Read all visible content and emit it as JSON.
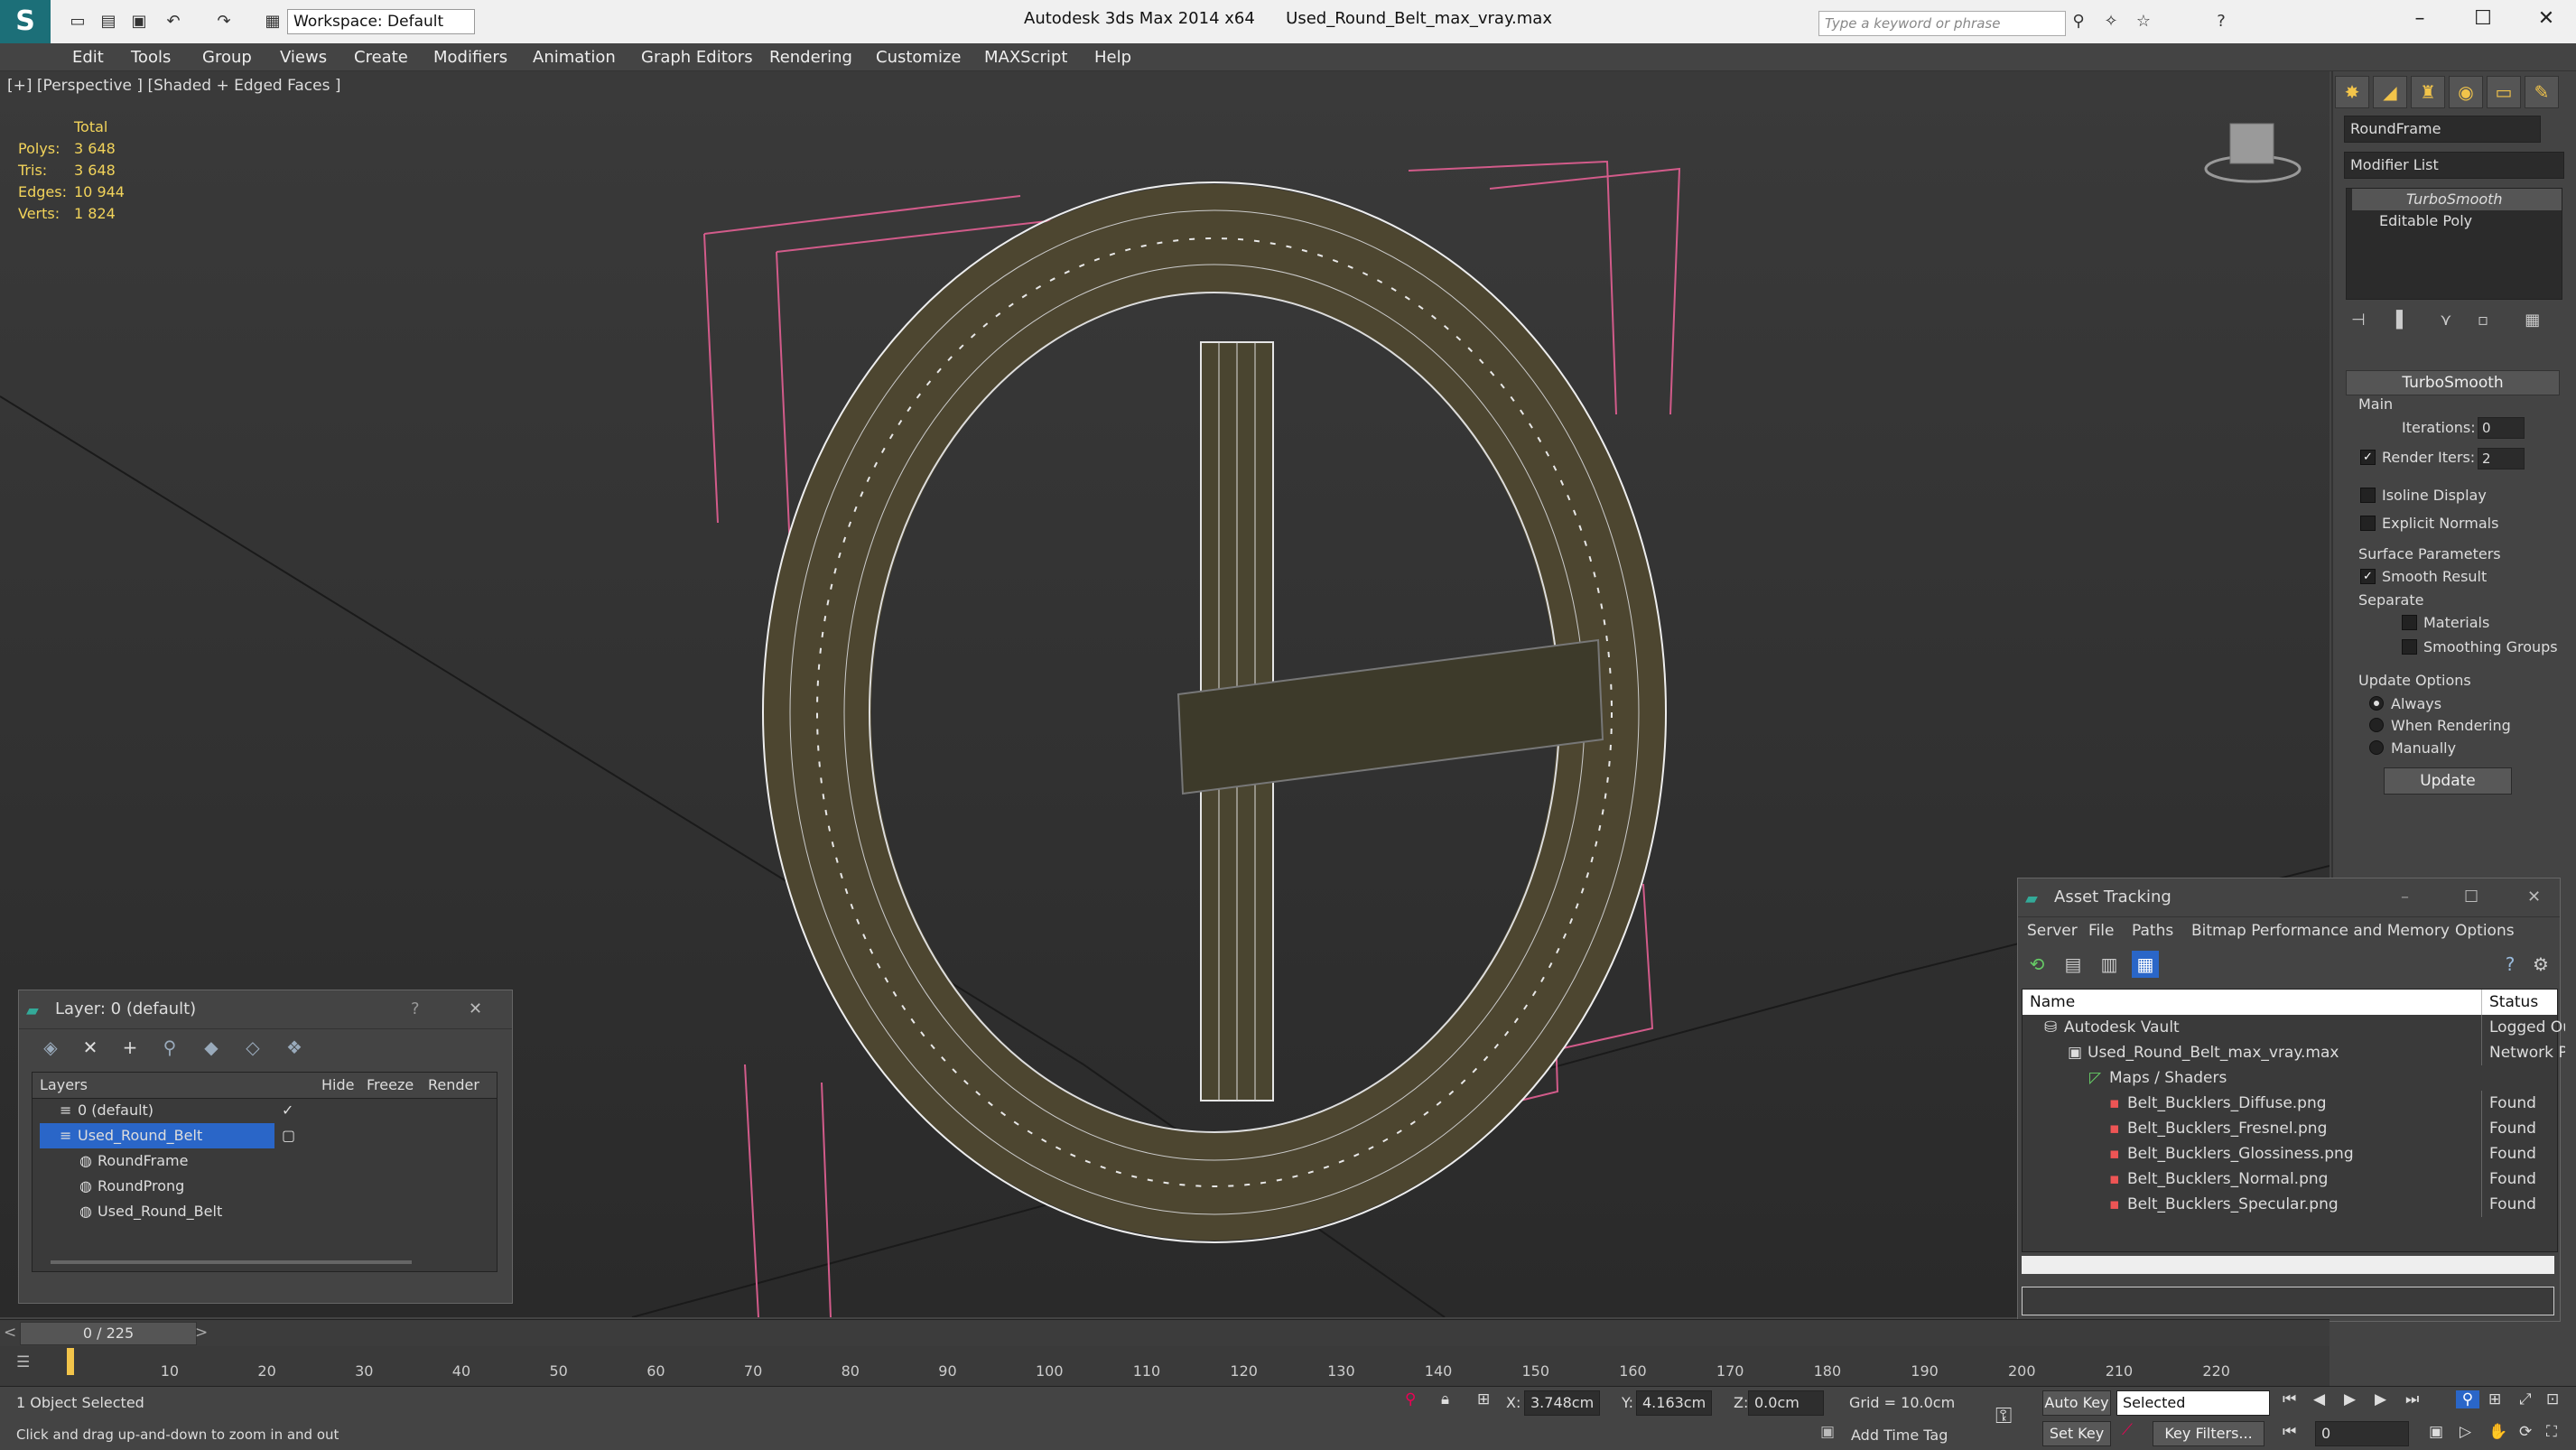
{
  "titlebar": {
    "app": "Autodesk 3ds Max  2014 x64",
    "file": "Used_Round_Belt_max_vray.max",
    "workspace": "Workspace: Default",
    "search_placeholder": "Type a keyword or phrase"
  },
  "menu": [
    "Edit",
    "Tools",
    "Group",
    "Views",
    "Create",
    "Modifiers",
    "Animation",
    "Graph Editors",
    "Rendering",
    "Customize",
    "MAXScript",
    "Help"
  ],
  "viewport": {
    "label": "[+] [Perspective ] [Shaded + Edged Faces ]",
    "stats_header": "Total",
    "stats": [
      {
        "k": "Polys:",
        "v": "3 648"
      },
      {
        "k": "Tris:",
        "v": "3 648"
      },
      {
        "k": "Edges:",
        "v": "10 944"
      },
      {
        "k": "Verts:",
        "v": "1 824"
      }
    ]
  },
  "command_panel": {
    "object_name": "RoundFrame",
    "modifier_list": "Modifier List",
    "stack": [
      "TurboSmooth",
      "Editable Poly"
    ],
    "rollout": "TurboSmooth",
    "main_label": "Main",
    "iterations_label": "Iterations:",
    "iterations": "0",
    "render_iters_label": "Render Iters:",
    "render_iters": "2",
    "isoline": "Isoline Display",
    "explicit": "Explicit Normals",
    "surface_label": "Surface Parameters",
    "smooth_result": "Smooth Result",
    "separate_label": "Separate",
    "materials": "Materials",
    "smoothing_groups": "Smoothing Groups",
    "update_options_label": "Update Options",
    "always": "Always",
    "when_rendering": "When Rendering",
    "manually": "Manually",
    "update_btn": "Update"
  },
  "layer_dialog": {
    "title": "Layer: 0 (default)",
    "help": "?",
    "headers": {
      "layers": "Layers",
      "hide": "Hide",
      "freeze": "Freeze",
      "render": "Render"
    },
    "rows": [
      "0 (default)",
      "Used_Round_Belt",
      "RoundFrame",
      "RoundProng",
      "Used_Round_Belt"
    ]
  },
  "asset_dialog": {
    "title": "Asset Tracking",
    "menu": [
      "Server",
      "File",
      "Paths",
      "Bitmap Performance and Memory",
      "Options"
    ],
    "headers": {
      "name": "Name",
      "status": "Status"
    },
    "rows": [
      {
        "name": "Autodesk Vault",
        "status": "Logged Ou"
      },
      {
        "name": "Used_Round_Belt_max_vray.max",
        "status": "Network P"
      },
      {
        "name": "Maps / Shaders",
        "status": ""
      },
      {
        "name": "Belt_Bucklers_Diffuse.png",
        "status": "Found"
      },
      {
        "name": "Belt_Bucklers_Fresnel.png",
        "status": "Found"
      },
      {
        "name": "Belt_Bucklers_Glossiness.png",
        "status": "Found"
      },
      {
        "name": "Belt_Bucklers_Normal.png",
        "status": "Found"
      },
      {
        "name": "Belt_Bucklers_Specular.png",
        "status": "Found"
      }
    ]
  },
  "timeline": {
    "frame": "0 / 225",
    "ticks": [
      "10",
      "20",
      "30",
      "40",
      "50",
      "60",
      "70",
      "80",
      "90",
      "100",
      "110",
      "120",
      "130",
      "140",
      "150",
      "160",
      "170",
      "180",
      "190",
      "200",
      "210",
      "220"
    ]
  },
  "status": {
    "selected": "1 Object Selected",
    "prompt": "Click and drag up-and-down to zoom in and out",
    "x_label": "X:",
    "x": "3.748cm",
    "y_label": "Y:",
    "y": "4.163cm",
    "z_label": "Z:",
    "z": "0.0cm",
    "grid": "Grid = 10.0cm",
    "add_time_tag": "Add Time Tag",
    "auto_key": "Auto Key",
    "set_key": "Set Key",
    "selected_dropdown": "Selected",
    "key_filters": "Key Filters...",
    "frame_field": "0"
  }
}
